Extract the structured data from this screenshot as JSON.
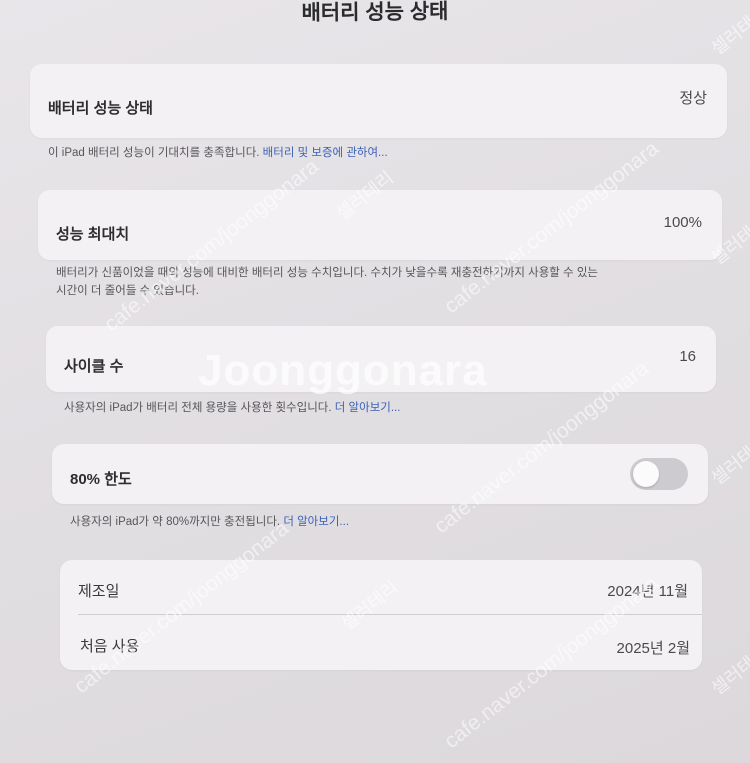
{
  "header": {
    "title": "배터리 성능 상태"
  },
  "battery_health": {
    "label": "배터리 성능 상태",
    "value": "정상",
    "note_text": "이 iPad 배터리 성능이 기대치를 충족합니다. ",
    "note_link": "배터리 및 보증에 관하여..."
  },
  "max_capacity": {
    "label": "성능 최대치",
    "value": "100%",
    "note_line1": "배터리가 신품이었을 때의 성능에 대비한 배터리 성능 수치입니다. 수치가 낮을수록 재충전하기까지 사용할 수 있는",
    "note_line2": "시간이 더 줄어들 수 있습니다."
  },
  "cycle_count": {
    "label": "사이클 수",
    "value": "16",
    "note_text": "사용자의 iPad가 배터리 전체 용량을 사용한 횟수입니다. ",
    "note_link": "더 알아보기..."
  },
  "limit_80": {
    "label": "80% 한도",
    "toggle_state": "off",
    "note_text": "사용자의 iPad가 약 80%까지만 충전됩니다. ",
    "note_link": "더 알아보기..."
  },
  "dates": {
    "manufactured_label": "제조일",
    "manufactured_value": "2024년 11월",
    "first_use_label": "처음 사용",
    "first_use_value": "2025년 2월"
  },
  "watermarks": {
    "brand": "Joonggonara",
    "url": "cafe.naver.com/joonggonara",
    "korean": "셀러테리"
  },
  "colors": {
    "link": "#3c61b8",
    "card": "#f3f1f4",
    "background": "#e4e1e5"
  }
}
